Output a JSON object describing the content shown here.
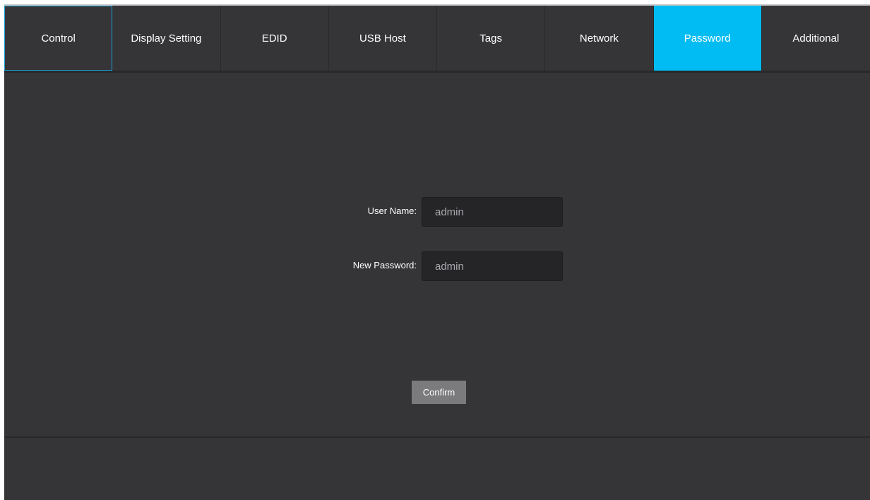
{
  "tabs": [
    {
      "label": "Control"
    },
    {
      "label": "Display Setting"
    },
    {
      "label": "EDID"
    },
    {
      "label": "USB Host"
    },
    {
      "label": "Tags"
    },
    {
      "label": "Network"
    },
    {
      "label": "Password"
    },
    {
      "label": "Additional"
    }
  ],
  "active_tab": "Password",
  "form": {
    "username_label": "User Name:",
    "username_value": "admin",
    "password_label": "New Password:",
    "password_value": "admin",
    "confirm_label": "Confirm"
  },
  "colors": {
    "active_tab": "#00bcf2",
    "background": "#353538",
    "input_background": "#252528",
    "button_background": "#7b7b7e"
  }
}
